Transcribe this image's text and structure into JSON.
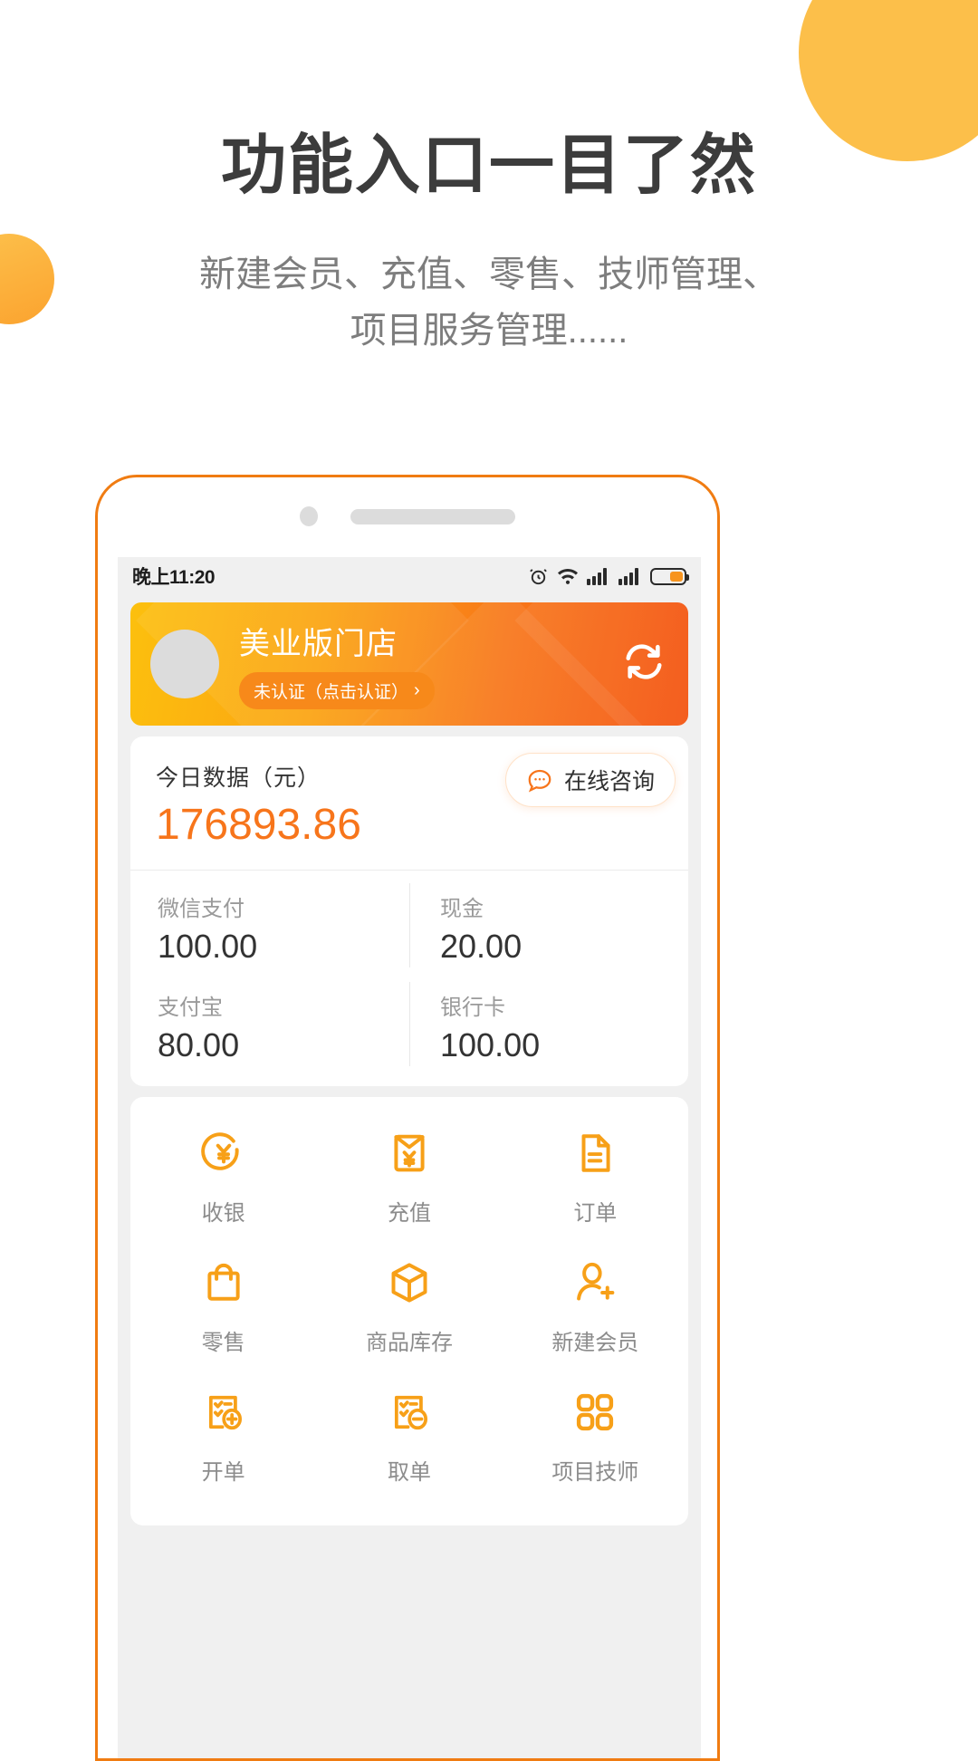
{
  "promo": {
    "headline": "功能入口一目了然",
    "subtitle_line1": "新建会员、充值、零售、技师管理、",
    "subtitle_line2": "项目服务管理......"
  },
  "colors": {
    "accent": "#f7751b",
    "brand_orange": "#f07c12",
    "banner_start": "#fcc00e",
    "banner_end": "#f4520f",
    "label_gray": "#8c8c8c"
  },
  "statusbar": {
    "time": "晚上11:20",
    "icons": [
      "alarm-icon",
      "wifi-icon",
      "signal-icon",
      "signal-icon",
      "battery-icon"
    ]
  },
  "banner": {
    "shop_name": "美业版门店",
    "verify_label": "未认证（点击认证）",
    "verify_chevron": "›",
    "refresh_icon": "refresh-icon",
    "avatar": "avatar"
  },
  "today_card": {
    "label": "今日数据（元）",
    "value": "176893.86",
    "consult_button": "在线咨询",
    "consult_icon": "chat-bubble-icon",
    "payments": [
      {
        "name": "微信支付",
        "amount": "100.00"
      },
      {
        "name": "现金",
        "amount": "20.00"
      },
      {
        "name": "支付宝",
        "amount": "80.00"
      },
      {
        "name": "银行卡",
        "amount": "100.00"
      }
    ]
  },
  "menu": {
    "rows": [
      [
        {
          "label": "收银",
          "icon": "yuan-circle-icon"
        },
        {
          "label": "充值",
          "icon": "envelope-yuan-icon"
        },
        {
          "label": "订单",
          "icon": "document-icon"
        }
      ],
      [
        {
          "label": "零售",
          "icon": "shopping-bag-icon"
        },
        {
          "label": "商品库存",
          "icon": "box-icon"
        },
        {
          "label": "新建会员",
          "icon": "user-plus-icon"
        }
      ],
      [
        {
          "label": "开单",
          "icon": "clipboard-plus-icon"
        },
        {
          "label": "取单",
          "icon": "clipboard-minus-icon"
        },
        {
          "label": "项目技师",
          "icon": "grid-four-icon"
        }
      ]
    ]
  }
}
